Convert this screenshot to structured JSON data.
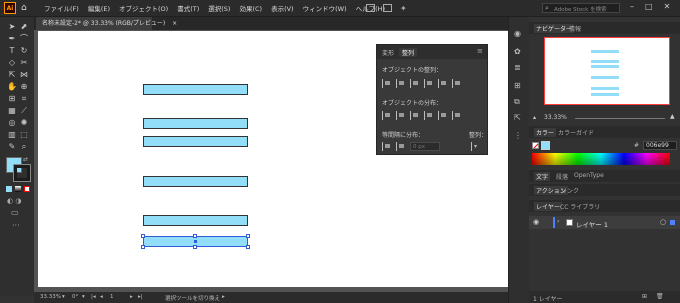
{
  "menubar": {
    "logo": "Ai",
    "items": [
      "ファイル(F)",
      "編集(E)",
      "オブジェクト(O)",
      "書式(T)",
      "選択(S)",
      "効果(C)",
      "表示(V)",
      "ウィンドウ(W)",
      "ヘルプ(H)"
    ],
    "search_placeholder": "Adobe Stock を検索"
  },
  "document": {
    "tab_label": "名称未設定-2* @ 33.33% (RGB/プレビュー)",
    "close_glyph": "×"
  },
  "statusbar": {
    "zoom": "33.33%",
    "angle": "0°",
    "artboard_number": "1",
    "tool_hint": "選択ツールを切り換え"
  },
  "align_panel": {
    "tabs": [
      "変形",
      "整列"
    ],
    "active_tab": "整列",
    "align_objects_label": "オブジェクトの整列：",
    "distribute_objects_label": "オブジェクトの分布：",
    "distribute_spacing_label": "等間隔に分布：",
    "align_to_label": "整列：",
    "spacing_value": "0 px"
  },
  "navigator": {
    "tabs": [
      "ナビゲーター",
      "情報"
    ],
    "zoom": "33.33%"
  },
  "color": {
    "tabs": [
      "カラー",
      "カラーガイド"
    ],
    "hex_label": "#",
    "hex_value": "006e99",
    "fill_color": "#92ddf8",
    "stroke_color": "#333333"
  },
  "type_tabs": [
    "文字",
    "段落",
    "OpenType"
  ],
  "actions_tabs": [
    "アクション",
    "リンク"
  ],
  "layers": {
    "tabs": [
      "レイヤー",
      "CC ライブラリ"
    ],
    "layer_name": "レイヤー 1",
    "footer": "1 レイヤー"
  },
  "icons": {
    "tools": [
      "selection-arrow",
      "direct-selection",
      "pen",
      "curvature",
      "type",
      "rotate",
      "eraser",
      "scissors",
      "scale",
      "width",
      "warp",
      "shape-builder",
      "perspective",
      "mesh",
      "gradient",
      "eyedropper",
      "blend",
      "symbol-sprayer",
      "column-graph",
      "artboard",
      "slice",
      "hand",
      "zoom"
    ]
  }
}
